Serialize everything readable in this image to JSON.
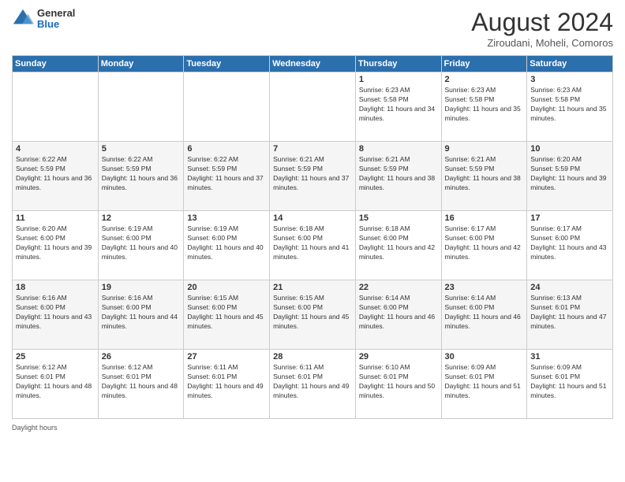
{
  "header": {
    "logo": {
      "general": "General",
      "blue": "Blue"
    },
    "month_title": "August 2024",
    "subtitle": "Ziroudani, Moheli, Comoros"
  },
  "days_of_week": [
    "Sunday",
    "Monday",
    "Tuesday",
    "Wednesday",
    "Thursday",
    "Friday",
    "Saturday"
  ],
  "weeks": [
    [
      {
        "day": "",
        "sunrise": "",
        "sunset": "",
        "daylight": ""
      },
      {
        "day": "",
        "sunrise": "",
        "sunset": "",
        "daylight": ""
      },
      {
        "day": "",
        "sunrise": "",
        "sunset": "",
        "daylight": ""
      },
      {
        "day": "",
        "sunrise": "",
        "sunset": "",
        "daylight": ""
      },
      {
        "day": "1",
        "sunrise": "Sunrise: 6:23 AM",
        "sunset": "Sunset: 5:58 PM",
        "daylight": "Daylight: 11 hours and 34 minutes."
      },
      {
        "day": "2",
        "sunrise": "Sunrise: 6:23 AM",
        "sunset": "Sunset: 5:58 PM",
        "daylight": "Daylight: 11 hours and 35 minutes."
      },
      {
        "day": "3",
        "sunrise": "Sunrise: 6:23 AM",
        "sunset": "Sunset: 5:58 PM",
        "daylight": "Daylight: 11 hours and 35 minutes."
      }
    ],
    [
      {
        "day": "4",
        "sunrise": "Sunrise: 6:22 AM",
        "sunset": "Sunset: 5:59 PM",
        "daylight": "Daylight: 11 hours and 36 minutes."
      },
      {
        "day": "5",
        "sunrise": "Sunrise: 6:22 AM",
        "sunset": "Sunset: 5:59 PM",
        "daylight": "Daylight: 11 hours and 36 minutes."
      },
      {
        "day": "6",
        "sunrise": "Sunrise: 6:22 AM",
        "sunset": "Sunset: 5:59 PM",
        "daylight": "Daylight: 11 hours and 37 minutes."
      },
      {
        "day": "7",
        "sunrise": "Sunrise: 6:21 AM",
        "sunset": "Sunset: 5:59 PM",
        "daylight": "Daylight: 11 hours and 37 minutes."
      },
      {
        "day": "8",
        "sunrise": "Sunrise: 6:21 AM",
        "sunset": "Sunset: 5:59 PM",
        "daylight": "Daylight: 11 hours and 38 minutes."
      },
      {
        "day": "9",
        "sunrise": "Sunrise: 6:21 AM",
        "sunset": "Sunset: 5:59 PM",
        "daylight": "Daylight: 11 hours and 38 minutes."
      },
      {
        "day": "10",
        "sunrise": "Sunrise: 6:20 AM",
        "sunset": "Sunset: 5:59 PM",
        "daylight": "Daylight: 11 hours and 39 minutes."
      }
    ],
    [
      {
        "day": "11",
        "sunrise": "Sunrise: 6:20 AM",
        "sunset": "Sunset: 6:00 PM",
        "daylight": "Daylight: 11 hours and 39 minutes."
      },
      {
        "day": "12",
        "sunrise": "Sunrise: 6:19 AM",
        "sunset": "Sunset: 6:00 PM",
        "daylight": "Daylight: 11 hours and 40 minutes."
      },
      {
        "day": "13",
        "sunrise": "Sunrise: 6:19 AM",
        "sunset": "Sunset: 6:00 PM",
        "daylight": "Daylight: 11 hours and 40 minutes."
      },
      {
        "day": "14",
        "sunrise": "Sunrise: 6:18 AM",
        "sunset": "Sunset: 6:00 PM",
        "daylight": "Daylight: 11 hours and 41 minutes."
      },
      {
        "day": "15",
        "sunrise": "Sunrise: 6:18 AM",
        "sunset": "Sunset: 6:00 PM",
        "daylight": "Daylight: 11 hours and 42 minutes."
      },
      {
        "day": "16",
        "sunrise": "Sunrise: 6:17 AM",
        "sunset": "Sunset: 6:00 PM",
        "daylight": "Daylight: 11 hours and 42 minutes."
      },
      {
        "day": "17",
        "sunrise": "Sunrise: 6:17 AM",
        "sunset": "Sunset: 6:00 PM",
        "daylight": "Daylight: 11 hours and 43 minutes."
      }
    ],
    [
      {
        "day": "18",
        "sunrise": "Sunrise: 6:16 AM",
        "sunset": "Sunset: 6:00 PM",
        "daylight": "Daylight: 11 hours and 43 minutes."
      },
      {
        "day": "19",
        "sunrise": "Sunrise: 6:16 AM",
        "sunset": "Sunset: 6:00 PM",
        "daylight": "Daylight: 11 hours and 44 minutes."
      },
      {
        "day": "20",
        "sunrise": "Sunrise: 6:15 AM",
        "sunset": "Sunset: 6:00 PM",
        "daylight": "Daylight: 11 hours and 45 minutes."
      },
      {
        "day": "21",
        "sunrise": "Sunrise: 6:15 AM",
        "sunset": "Sunset: 6:00 PM",
        "daylight": "Daylight: 11 hours and 45 minutes."
      },
      {
        "day": "22",
        "sunrise": "Sunrise: 6:14 AM",
        "sunset": "Sunset: 6:00 PM",
        "daylight": "Daylight: 11 hours and 46 minutes."
      },
      {
        "day": "23",
        "sunrise": "Sunrise: 6:14 AM",
        "sunset": "Sunset: 6:00 PM",
        "daylight": "Daylight: 11 hours and 46 minutes."
      },
      {
        "day": "24",
        "sunrise": "Sunrise: 6:13 AM",
        "sunset": "Sunset: 6:01 PM",
        "daylight": "Daylight: 11 hours and 47 minutes."
      }
    ],
    [
      {
        "day": "25",
        "sunrise": "Sunrise: 6:12 AM",
        "sunset": "Sunset: 6:01 PM",
        "daylight": "Daylight: 11 hours and 48 minutes."
      },
      {
        "day": "26",
        "sunrise": "Sunrise: 6:12 AM",
        "sunset": "Sunset: 6:01 PM",
        "daylight": "Daylight: 11 hours and 48 minutes."
      },
      {
        "day": "27",
        "sunrise": "Sunrise: 6:11 AM",
        "sunset": "Sunset: 6:01 PM",
        "daylight": "Daylight: 11 hours and 49 minutes."
      },
      {
        "day": "28",
        "sunrise": "Sunrise: 6:11 AM",
        "sunset": "Sunset: 6:01 PM",
        "daylight": "Daylight: 11 hours and 49 minutes."
      },
      {
        "day": "29",
        "sunrise": "Sunrise: 6:10 AM",
        "sunset": "Sunset: 6:01 PM",
        "daylight": "Daylight: 11 hours and 50 minutes."
      },
      {
        "day": "30",
        "sunrise": "Sunrise: 6:09 AM",
        "sunset": "Sunset: 6:01 PM",
        "daylight": "Daylight: 11 hours and 51 minutes."
      },
      {
        "day": "31",
        "sunrise": "Sunrise: 6:09 AM",
        "sunset": "Sunset: 6:01 PM",
        "daylight": "Daylight: 11 hours and 51 minutes."
      }
    ]
  ],
  "footer": {
    "daylight_label": "Daylight hours"
  }
}
